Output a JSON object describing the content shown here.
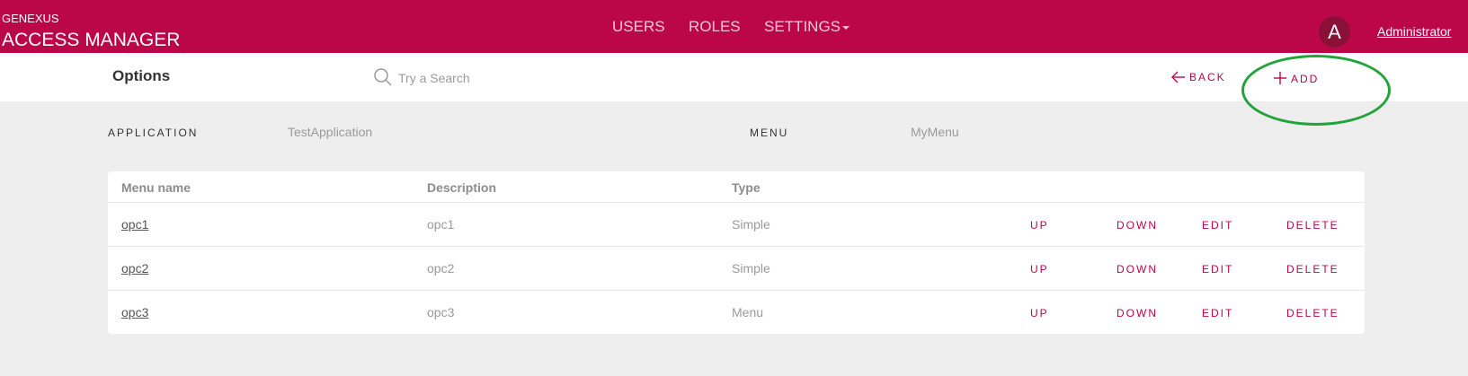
{
  "header": {
    "brand_small": "GENEXUS",
    "brand_big": "ACCESS MANAGER",
    "nav": [
      {
        "label": "USERS"
      },
      {
        "label": "ROLES"
      },
      {
        "label": "SETTINGS"
      }
    ],
    "avatar_letter": "A",
    "user": "Administrator"
  },
  "toolbar": {
    "title": "Options",
    "search_placeholder": "Try a Search",
    "back_label": "BACK",
    "add_label": "ADD"
  },
  "filters": {
    "application_label": "APPLICATION",
    "application_value": "TestApplication",
    "menu_label": "MENU",
    "menu_value": "MyMenu"
  },
  "table": {
    "columns": [
      "Menu name",
      "Description",
      "Type"
    ],
    "rows": [
      {
        "name": "opc1",
        "description": "opc1",
        "type": "Simple",
        "actions": [
          "UP",
          "DOWN",
          "EDIT",
          "DELETE"
        ]
      },
      {
        "name": "opc2",
        "description": "opc2",
        "type": "Simple",
        "actions": [
          "UP",
          "DOWN",
          "EDIT",
          "DELETE"
        ]
      },
      {
        "name": "opc3",
        "description": "opc3",
        "type": "Menu",
        "actions": [
          "UP",
          "DOWN",
          "EDIT",
          "DELETE"
        ]
      }
    ]
  },
  "colors": {
    "brand": "#bb0648",
    "highlight": "#22a43a",
    "background": "#eeeeee"
  },
  "icons": [
    "search-icon",
    "arrow-left-icon",
    "plus-icon"
  ]
}
